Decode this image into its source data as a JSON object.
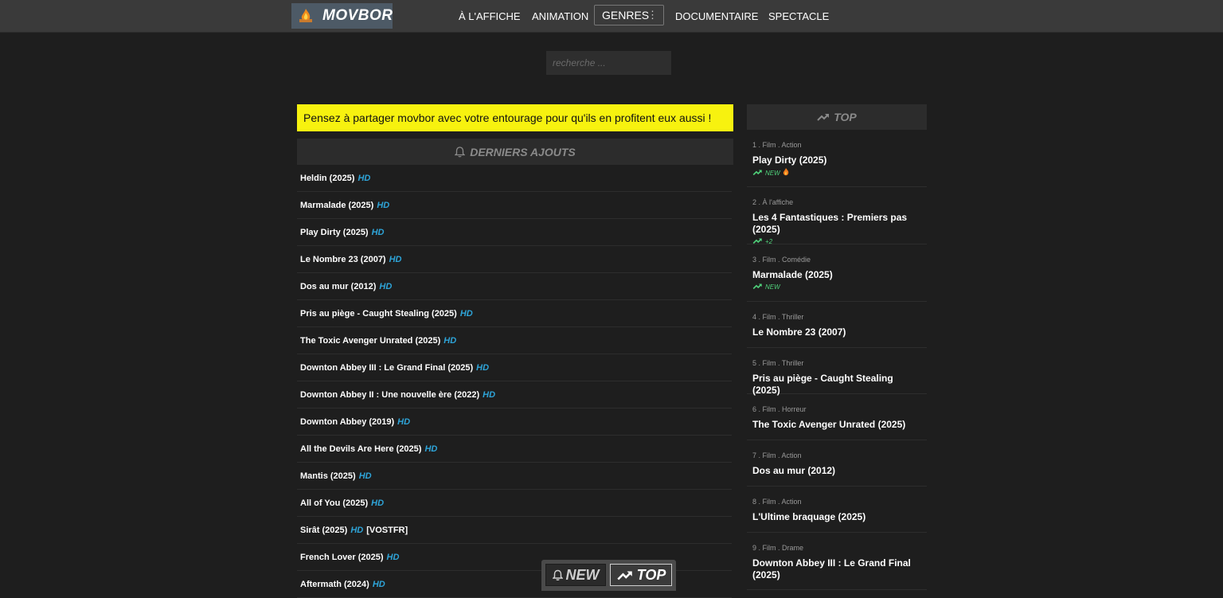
{
  "header": {
    "logo_text": "MOVBOR",
    "nav": {
      "affiche": "À L'AFFICHE",
      "animation": "ANIMATION",
      "genres": "GENRES",
      "documentaire": "DOCUMENTAIRE",
      "spectacle": "SPECTACLE"
    }
  },
  "search": {
    "placeholder": "recherche ..."
  },
  "banner": {
    "text": "Pensez à partager movbor avec votre entourage pour qu'ils en profitent eux aussi !"
  },
  "latest": {
    "title": "DERNIERS AJOUTS",
    "quality_label": "HD",
    "items": [
      {
        "title": "Heldin (2025)",
        "extra": ""
      },
      {
        "title": "Marmalade (2025)",
        "extra": ""
      },
      {
        "title": "Play Dirty (2025)",
        "extra": ""
      },
      {
        "title": "Le Nombre 23 (2007)",
        "extra": ""
      },
      {
        "title": "Dos au mur (2012)",
        "extra": ""
      },
      {
        "title": "Pris au piège - Caught Stealing (2025)",
        "extra": ""
      },
      {
        "title": "The Toxic Avenger Unrated (2025)",
        "extra": ""
      },
      {
        "title": "Downton Abbey III : Le Grand Final (2025)",
        "extra": ""
      },
      {
        "title": "Downton Abbey II : Une nouvelle ère (2022)",
        "extra": ""
      },
      {
        "title": "Downton Abbey (2019)",
        "extra": ""
      },
      {
        "title": "All the Devils Are Here (2025)",
        "extra": ""
      },
      {
        "title": "Mantis (2025)",
        "extra": ""
      },
      {
        "title": "All of You (2025)",
        "extra": ""
      },
      {
        "title": "Sirât (2025)",
        "extra": "[VOSTFR]"
      },
      {
        "title": "French Lover (2025)",
        "extra": ""
      },
      {
        "title": "Aftermath (2024)",
        "extra": ""
      }
    ]
  },
  "top": {
    "title": "TOP",
    "items": [
      {
        "meta": "1 . Film . Action",
        "title": "Play Dirty (2025)",
        "badge": "NEW",
        "fire": true
      },
      {
        "meta": "2 . À l'affiche",
        "title": "Les 4 Fantastiques : Premiers pas (2025)",
        "badge": "+2",
        "fire": false
      },
      {
        "meta": "3 . Film . Comédie",
        "title": "Marmalade (2025)",
        "badge": "NEW",
        "fire": false
      },
      {
        "meta": "4 . Film . Thriller",
        "title": "Le Nombre 23 (2007)",
        "badge": "",
        "fire": false
      },
      {
        "meta": "5 . Film . Thriller",
        "title": "Pris au piège - Caught Stealing (2025)",
        "badge": "",
        "fire": false
      },
      {
        "meta": "6 . Film . Horreur",
        "title": "The Toxic Avenger Unrated (2025)",
        "badge": "",
        "fire": false
      },
      {
        "meta": "7 . Film . Action",
        "title": "Dos au mur (2012)",
        "badge": "",
        "fire": false
      },
      {
        "meta": "8 . Film . Action",
        "title": "L'Ultime braquage (2025)",
        "badge": "",
        "fire": false
      },
      {
        "meta": "9 . Film . Drame",
        "title": "Downton Abbey III : Le Grand Final (2025)",
        "badge": "",
        "fire": false
      }
    ]
  },
  "bottom_nav": {
    "new_label": "NEW",
    "top_label": "TOP"
  },
  "colors": {
    "hd": "#2ea4d8",
    "banner": "#f7f20f",
    "trend": "#4fd07a"
  }
}
